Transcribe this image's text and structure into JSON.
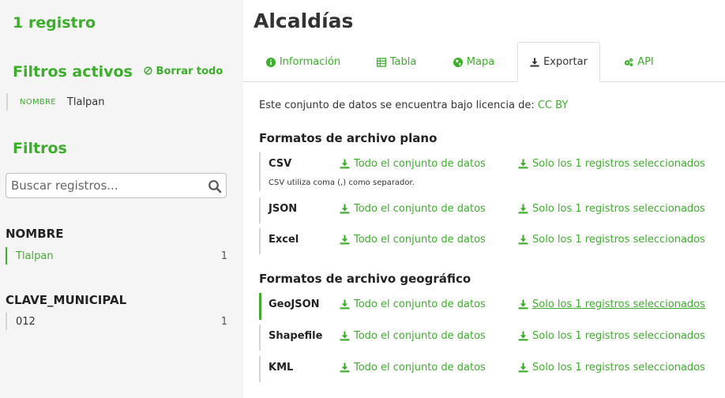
{
  "sidebar": {
    "record_count": "1 registro",
    "active_filters_title": "Filtros activos",
    "clear_all": "Borrar todo",
    "active_filter": {
      "field": "NOMBRE",
      "value": "Tlalpan"
    },
    "filters_title": "Filtros",
    "search_placeholder": "Buscar registros...",
    "facets": [
      {
        "title": "NOMBRE",
        "items": [
          {
            "label": "Tlalpan",
            "count": "1",
            "selected": true
          }
        ]
      },
      {
        "title": "CLAVE_MUNICIPAL",
        "items": [
          {
            "label": "012",
            "count": "1",
            "selected": false
          }
        ]
      }
    ]
  },
  "main": {
    "title": "Alcaldías",
    "tabs": [
      {
        "label": "Información",
        "icon": "info-circle-icon"
      },
      {
        "label": "Tabla",
        "icon": "table-icon"
      },
      {
        "label": "Mapa",
        "icon": "globe-icon"
      },
      {
        "label": "Exportar",
        "icon": "download-icon",
        "active": true
      },
      {
        "label": "API",
        "icon": "gears-icon"
      }
    ],
    "license_text": "Este conjunto de datos se encuentra bajo licencia de:",
    "license_link": "CC BY",
    "flat_title": "Formatos de archivo plano",
    "geo_title": "Formatos de archivo geográfico",
    "all_label": "Todo el conjunto de datos",
    "selected_label": "Solo los 1 registros seleccionados",
    "flat_formats": [
      {
        "name": "CSV",
        "note": "CSV utiliza coma (,) como separador."
      },
      {
        "name": "JSON"
      },
      {
        "name": "Excel"
      }
    ],
    "geo_formats": [
      {
        "name": "GeoJSON"
      },
      {
        "name": "Shapefile"
      },
      {
        "name": "KML"
      }
    ]
  },
  "colors": {
    "accent": "#3cae2b",
    "sidebar_bg": "#f5f5f5",
    "text": "#333333"
  }
}
